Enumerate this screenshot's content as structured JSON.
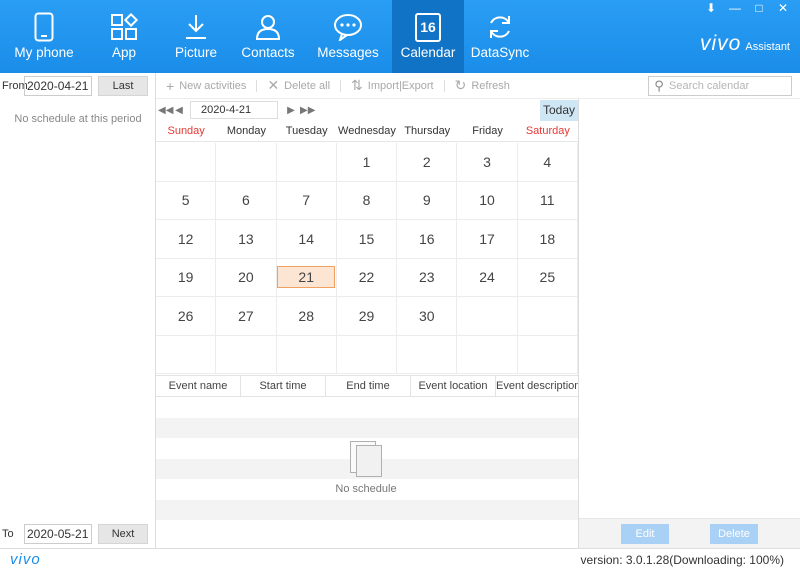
{
  "nav": {
    "items": [
      {
        "label": "My phone",
        "icon": "phone-icon"
      },
      {
        "label": "App",
        "icon": "app-grid-icon"
      },
      {
        "label": "Picture",
        "icon": "download-icon"
      },
      {
        "label": "Contacts",
        "icon": "person-icon"
      },
      {
        "label": "Messages",
        "icon": "chat-bubble-icon"
      },
      {
        "label": "Calendar",
        "icon": "calendar-icon",
        "badge": "16",
        "active": true
      },
      {
        "label": "DataSync",
        "icon": "sync-icon"
      }
    ]
  },
  "brand": {
    "logo": "vivo",
    "subtitle": "Assistant"
  },
  "window": {
    "download": "⬇",
    "minimize": "—",
    "maximize": "□",
    "close": "✕"
  },
  "left": {
    "from_label": "From",
    "from_date": "2020-04-21",
    "last_label": "Last",
    "empty_text": "No schedule at this period",
    "to_label": "To",
    "to_date": "2020-05-21",
    "next_label": "Next"
  },
  "toolbar": {
    "new_label": "New activities",
    "delete_all_label": "Delete all",
    "import_export_label": "Import|Export",
    "refresh_label": "Refresh",
    "search_placeholder": "Search calendar"
  },
  "calendar": {
    "current_date": "2020-4-21",
    "today_label": "Today",
    "weekdays": [
      "Sunday",
      "Monday",
      "Tuesday",
      "Wednesday",
      "Thursday",
      "Friday",
      "Saturday"
    ],
    "selected_day": "21",
    "days": [
      "",
      "",
      "",
      "1",
      "2",
      "3",
      "4",
      "5",
      "6",
      "7",
      "8",
      "9",
      "10",
      "11",
      "12",
      "13",
      "14",
      "15",
      "16",
      "17",
      "18",
      "19",
      "20",
      "21",
      "22",
      "23",
      "24",
      "25",
      "26",
      "27",
      "28",
      "29",
      "30",
      "",
      "",
      "",
      "",
      "",
      "",
      "",
      "",
      ""
    ]
  },
  "events": {
    "columns": [
      "Event name",
      "Start time",
      "End time",
      "Event location",
      "Event description"
    ],
    "empty_text": "No schedule"
  },
  "detail": {
    "edit_label": "Edit",
    "delete_label": "Delete"
  },
  "footer": {
    "logo": "vivo",
    "version": "version: 3.0.1.28(Downloading:  100%)"
  },
  "colors": {
    "accent": "#1a8de9",
    "weekend": "#e53935",
    "selected_fill": "#fde5d3",
    "selected_border": "#f0a060"
  }
}
